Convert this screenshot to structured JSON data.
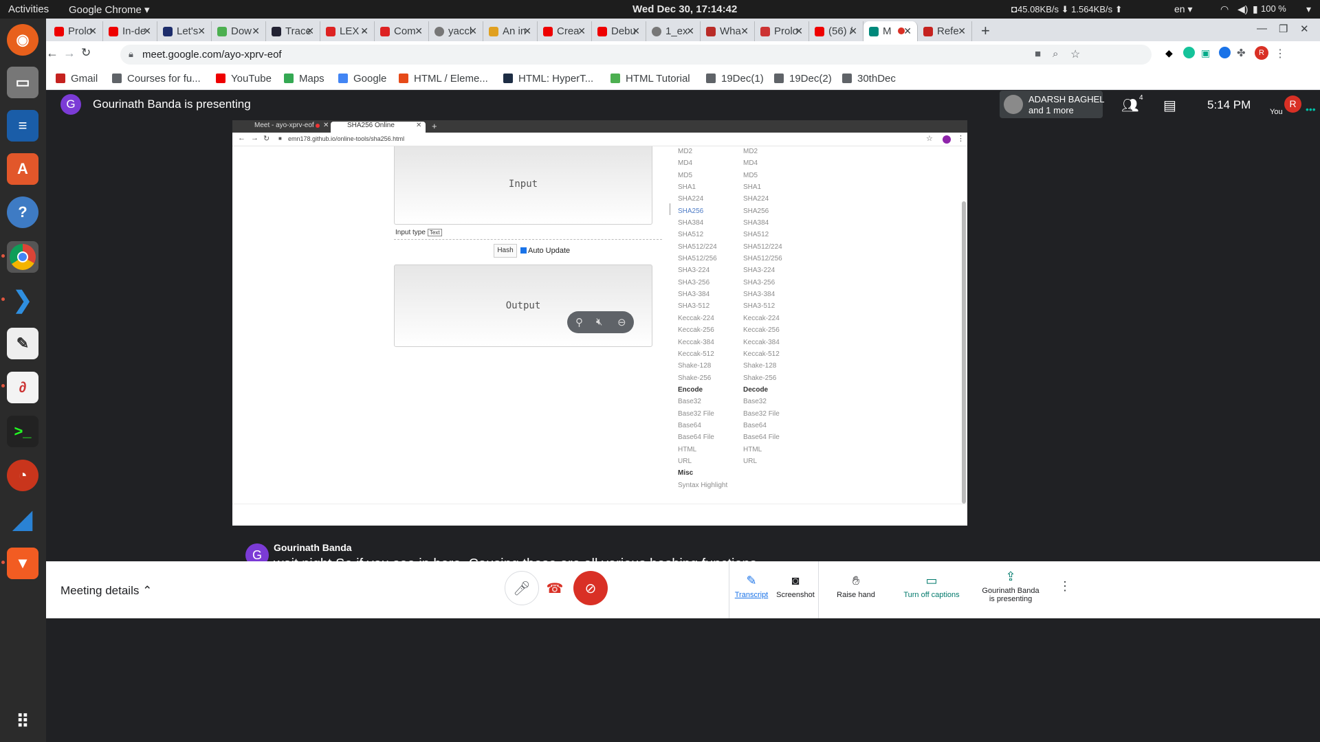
{
  "system": {
    "activities": "Activities",
    "app_name": "Google Chrome ▾",
    "clock": "Wed Dec 30, 17:14:42",
    "net_up": "45.08KB/s",
    "net_down": "1.564KB/s",
    "lang": "en ▾",
    "battery": "100 %"
  },
  "chrome": {
    "tabs": [
      "Prolo",
      "In-de",
      "Let's",
      "Dow",
      "Trace",
      "LEX -",
      "Com",
      "yaccl",
      "An in",
      "Crea",
      "Debu",
      "1_ex",
      "Wha",
      "Prolo",
      "(56) /",
      "M",
      "Refe"
    ],
    "url": "meet.google.com/ayo-xprv-eof",
    "bookmarks": [
      "Gmail",
      "Courses for fu...",
      "YouTube",
      "Maps",
      "Google",
      "HTML / Eleme...",
      "HTML: HyperT...",
      "HTML Tutorial",
      "19Dec(1)",
      "19Dec(2)",
      "30thDec"
    ]
  },
  "meet": {
    "presenter_initial": "G",
    "presenting_text": "Gourinath Banda is presenting",
    "participant_name": "ADARSH BAGHEL",
    "participant_more": "and 1 more",
    "people_count": "4",
    "time": "5:14 PM",
    "you_initial": "R",
    "you_label": "You",
    "caption_name": "Gourinath Banda",
    "caption_text": "wait night So if you see in here. Causing these are all various hashing functions.",
    "meeting_details": "Meeting details",
    "actions": {
      "transcript": "Transcript",
      "screenshot": "Screenshot",
      "raise_hand": "Raise hand",
      "captions": "Turn off captions",
      "presenting_1": "Gourinath Banda",
      "presenting_2": "is presenting"
    }
  },
  "shared_screen": {
    "tab1": "Meet - ayo-xprv-eof",
    "tab2": "SHA256 Online",
    "url": "emn178.github.io/online-tools/sha256.html",
    "input_placeholder": "Input",
    "input_type_label": "Input type",
    "input_type_value": "Text",
    "hash_button": "Hash",
    "auto_update": "Auto Update",
    "output_placeholder": "Output",
    "hash_list": [
      "MD2",
      "MD4",
      "MD5",
      "SHA1",
      "SHA224",
      "SHA256",
      "SHA384",
      "SHA512",
      "SHA512/224",
      "SHA512/256",
      "SHA3-224",
      "SHA3-256",
      "SHA3-384",
      "SHA3-512",
      "Keccak-224",
      "Keccak-256",
      "Keccak-384",
      "Keccak-512",
      "Shake-128",
      "Shake-256"
    ],
    "encode_header": "Encode",
    "decode_header": "Decode",
    "encode_list": [
      "Base32",
      "Base32 File",
      "Base64",
      "Base64 File",
      "HTML",
      "URL"
    ],
    "misc_header": "Misc",
    "misc_list": [
      "Syntax Highlight"
    ],
    "selected": "SHA256"
  }
}
